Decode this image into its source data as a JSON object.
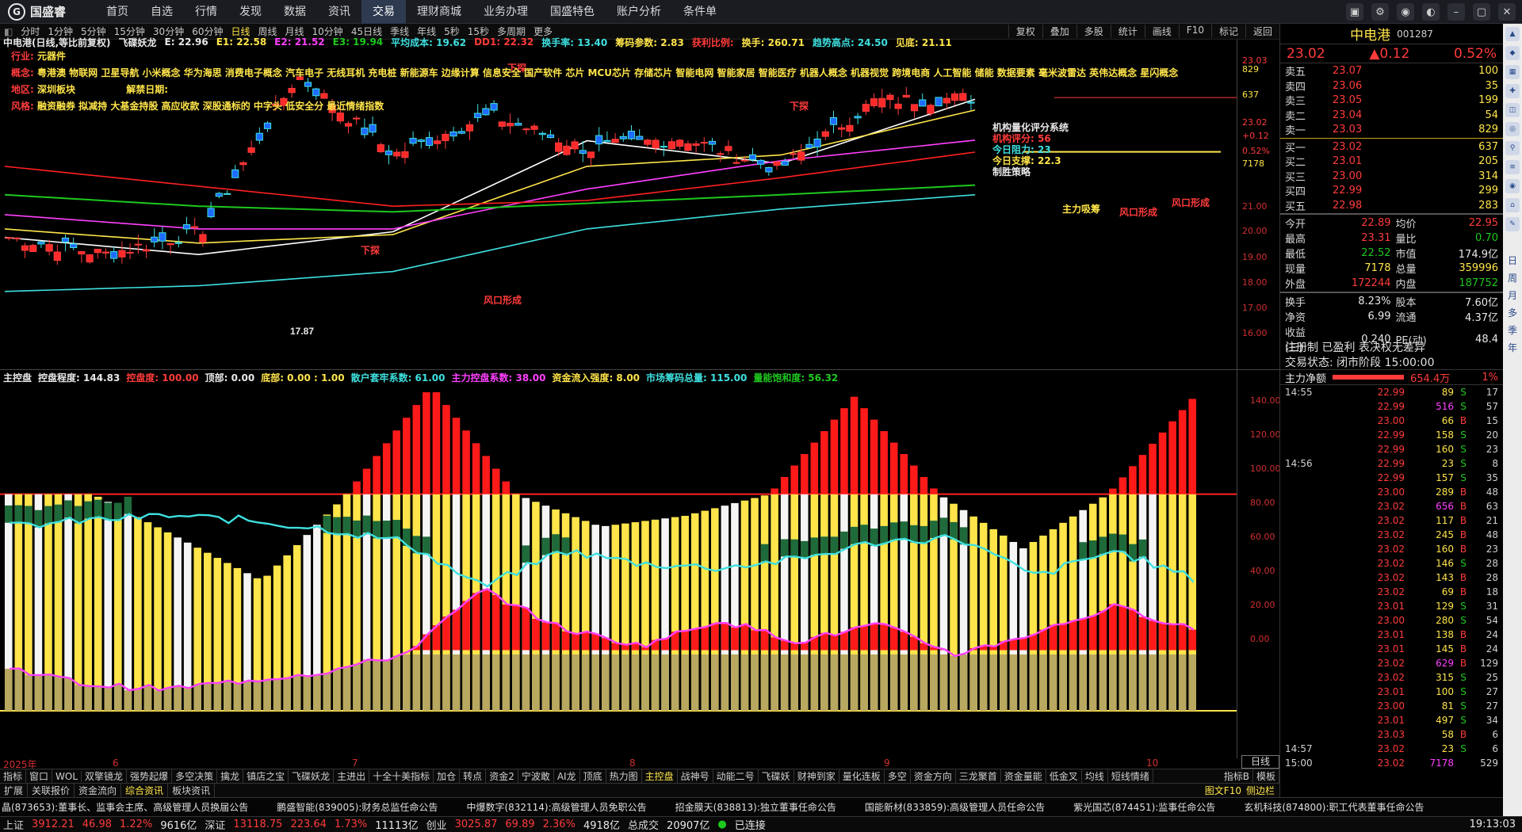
{
  "app": {
    "logo_text": "国盛睿"
  },
  "menu": [
    "首页",
    "自选",
    "行情",
    "发现",
    "数据",
    "资讯",
    "交易",
    "理财商城",
    "业务办理",
    "国盛特色",
    "账户分析",
    "条件单"
  ],
  "menu_active_index": 6,
  "periods": [
    "分时",
    "1分钟",
    "5分钟",
    "15分钟",
    "30分钟",
    "60分钟",
    "日线",
    "周线",
    "月线",
    "10分钟",
    "45日线",
    "季线",
    "年线",
    "5秒",
    "15秒",
    "多周期",
    "更多"
  ],
  "period_active_index": 6,
  "period_right": [
    "复权",
    "叠加",
    "多股",
    "统计",
    "画线",
    "F10",
    "标记",
    "返回"
  ],
  "info_line": [
    {
      "text": "中电港(日线,等比前复权)",
      "color": "#e8e8e8"
    },
    {
      "text": "飞碟妖龙",
      "color": "#e8e8e8"
    },
    {
      "text": "E: 22.96",
      "color": "#e8e8e8"
    },
    {
      "text": "E1: 22.58",
      "color": "#ffe54a"
    },
    {
      "text": "E2: 21.52",
      "color": "#ff40ff"
    },
    {
      "text": "E3: 19.94",
      "color": "#1ec81e"
    },
    {
      "text": "平均成本: 19.62",
      "color": "#3fe0e0"
    },
    {
      "text": "DD1: 22.32",
      "color": "#ff3b3b"
    },
    {
      "text": "换手率: 13.40",
      "color": "#3fe0e0"
    },
    {
      "text": "筹码参数: 2.83",
      "color": "#ffe54a"
    },
    {
      "text": "获利比例:",
      "color": "#ff3b3b"
    },
    {
      "text": "换手: 260.71",
      "color": "#ffe54a"
    },
    {
      "text": "趋势高点: 24.50",
      "color": "#3fe0e0"
    },
    {
      "text": "见底: 21.11",
      "color": "#ffe54a"
    }
  ],
  "overlay_text": {
    "industry_label": "行业:",
    "industry_value": "元器件",
    "concept_label": "概念:",
    "concept_value": "粤港澳 物联网 卫星导航 小米概念 华为海思 消费电子概念 汽车电子 无线耳机 充电桩 新能源车 边缘计算 信息安全 国产软件 芯片 MCU芯片 存储芯片 智能电网 智能家居 智能医疗 机器人概念 机器视觉 跨境电商 人工智能 储能 数据要素 毫米波雷达 英伟达概念 星闪概念",
    "region_label": "地区:",
    "region_value": "深圳板块",
    "unban_label": "解禁日期:",
    "style_label": "风格:",
    "style_value": "融资融券 拟减持 大基金持股 高应收款 深股通标的 中字头 低安全分 最近情绪指数",
    "rating_title": "机构量化评分系统",
    "rating_lines": [
      "机构评分: 56",
      "今日阻力: 23",
      "今日支撑: 22.3",
      "制胜策略"
    ],
    "annotations": [
      "风口形成",
      "风口形成",
      "风口形成",
      "主力吸筹",
      "下探",
      "下探",
      "下探",
      "17.87"
    ]
  },
  "price_axis": [
    "23.03",
    "829",
    "637",
    "23.02",
    "+0.12",
    "0.52%",
    "7178",
    "21.00",
    "20.00",
    "19.00",
    "18.00",
    "17.00",
    "16.00"
  ],
  "chart_data": [
    {
      "type": "line",
      "title": "中电港(日线,等比前复权)",
      "subtitle": "飞碟妖龙",
      "ylim": [
        16.0,
        24.5
      ],
      "x": [
        "2025-05",
        "2025-06",
        "2025-07",
        "2025-08",
        "2025-09",
        "2025-10"
      ],
      "series": [
        {
          "name": "E",
          "values": [
            18.1,
            17.5,
            18.3,
            21.5,
            20.7,
            22.96
          ]
        },
        {
          "name": "E1",
          "values": [
            18.4,
            17.9,
            18.2,
            20.6,
            21.0,
            22.58
          ]
        },
        {
          "name": "E2",
          "values": [
            18.9,
            18.4,
            18.4,
            19.8,
            20.8,
            21.52
          ]
        },
        {
          "name": "E3",
          "values": [
            19.6,
            19.2,
            19.0,
            19.3,
            19.6,
            19.94
          ]
        }
      ],
      "highlights": {
        "trend_high": 24.5,
        "bottom": 21.11
      }
    },
    {
      "type": "bar",
      "title": "主控盘",
      "ylim": [
        0,
        150
      ],
      "yticks": [
        0,
        20,
        40,
        60,
        80,
        100,
        120,
        140
      ],
      "categories": [
        "6",
        "7",
        "8",
        "9",
        "10"
      ],
      "series": [
        {
          "name": "控盘程度",
          "values": [
            100,
            100,
            100,
            100,
            144.83
          ]
        },
        {
          "name": "散户套牢系数",
          "values": [
            60,
            72,
            71,
            75,
            61
          ]
        },
        {
          "name": "主力控盘系数",
          "values": [
            12,
            17,
            31,
            35,
            38
          ]
        }
      ],
      "labels": {
        "控盘程度": "144.83",
        "控盘度": "100.00",
        "顶部": "0.00",
        "底部": "0.00 : 1.00",
        "散户套牢系数": "61.00",
        "主力控盘系数": "38.00",
        "资金流入强度": "8.00",
        "市场筹码总量": "115.00",
        "量能饱和度": "56.32"
      }
    }
  ],
  "sub_info": [
    {
      "text": "主控盘",
      "color": "#e8e8e8"
    },
    {
      "text": "控盘程度: 144.83",
      "color": "#e8e8e8"
    },
    {
      "text": "控盘度: 100.00",
      "color": "#ff3b3b"
    },
    {
      "text": "顶部: 0.00",
      "color": "#e8e8e8"
    },
    {
      "text": "底部: 0.00 : 1.00",
      "color": "#ffe54a"
    },
    {
      "text": "散户套牢系数: 61.00",
      "color": "#3fe0e0"
    },
    {
      "text": "主力控盘系数: 38.00",
      "color": "#ff40ff"
    },
    {
      "text": "资金流入强度: 8.00",
      "color": "#ffe54a"
    },
    {
      "text": "市场筹码总量: 115.00",
      "color": "#3fe0e0"
    },
    {
      "text": "量能饱和度: 56.32",
      "color": "#1ec81e"
    }
  ],
  "sub_axis": [
    "140.00",
    "120.00",
    "100.00",
    "80.00",
    "60.00",
    "40.00",
    "20.00",
    "0.00"
  ],
  "x_axis_labels": [
    "2025年",
    "6",
    "7",
    "8",
    "9",
    "10"
  ],
  "x_axis_label_box": "日线",
  "indicator_tabs": [
    "指标",
    "窗口",
    "WOL",
    "双擎镜龙",
    "强势起爆",
    "多空决策",
    "擒龙",
    "镇店之宝",
    "飞碟妖龙",
    "主进出",
    "十全十美指标",
    "加仓",
    "转点",
    "资金2",
    "宁波敢",
    "AI龙",
    "顶底",
    "热力图",
    "主控盘",
    "战神号",
    "动能二号",
    "飞碟妖",
    "财神到家",
    "量化连板",
    "多空",
    "资金方向",
    "三龙聚首",
    "资金量能",
    "低金叉",
    "均线",
    "短线情绪"
  ],
  "indicator_active_index": 18,
  "indicator_tabs_right": [
    "指标B",
    "模板"
  ],
  "tabs2": [
    "扩展",
    "关联报价",
    "资金流向",
    "综合资讯",
    "板块资讯"
  ],
  "tabs2_active_index": 3,
  "tabs2_right": [
    "图文F10",
    "侧边栏"
  ],
  "right_panel": {
    "name": "中电港",
    "code": "001287",
    "price": "23.02",
    "change": "▲0.12",
    "pct": "0.52%",
    "asks": [
      {
        "label": "卖五",
        "price": "23.07",
        "vol": "100"
      },
      {
        "label": "卖四",
        "price": "23.06",
        "vol": "35"
      },
      {
        "label": "卖三",
        "price": "23.05",
        "vol": "199"
      },
      {
        "label": "卖二",
        "price": "23.04",
        "vol": "54"
      },
      {
        "label": "卖一",
        "price": "23.03",
        "vol": "829"
      }
    ],
    "bids": [
      {
        "label": "买一",
        "price": "23.02",
        "vol": "637"
      },
      {
        "label": "买二",
        "price": "23.01",
        "vol": "205"
      },
      {
        "label": "买三",
        "price": "23.00",
        "vol": "314"
      },
      {
        "label": "买四",
        "price": "22.99",
        "vol": "299"
      },
      {
        "label": "买五",
        "price": "22.98",
        "vol": "283"
      }
    ],
    "stats": [
      {
        "k1": "今开",
        "v1": "22.89",
        "c1": "#ff3b3b",
        "k2": "均价",
        "v2": "22.95",
        "c2": "#ff3b3b"
      },
      {
        "k1": "最高",
        "v1": "23.31",
        "c1": "#ff3b3b",
        "k2": "量比",
        "v2": "0.70",
        "c2": "#1ec81e"
      },
      {
        "k1": "最低",
        "v1": "22.52",
        "c1": "#1ec81e",
        "k2": "市值",
        "v2": "174.9亿",
        "c2": "#e8e8e8"
      },
      {
        "k1": "现量",
        "v1": "7178",
        "c1": "#ffe54a",
        "k2": "总量",
        "v2": "359996",
        "c2": "#ffe54a"
      },
      {
        "k1": "外盘",
        "v1": "172244",
        "c1": "#ff3b3b",
        "k2": "内盘",
        "v2": "187752",
        "c2": "#1ec81e"
      }
    ],
    "stats2": [
      {
        "k1": "换手",
        "v1": "8.23%",
        "c1": "#e8e8e8",
        "k2": "股本",
        "v2": "7.60亿",
        "c2": "#e8e8e8"
      },
      {
        "k1": "净资",
        "v1": "6.99",
        "c1": "#e8e8e8",
        "k2": "流通",
        "v2": "4.37亿",
        "c2": "#e8e8e8"
      },
      {
        "k1": "收益(三)",
        "v1": "0.240",
        "c1": "#e8e8e8",
        "k2": "PE(动)",
        "v2": "48.4",
        "c2": "#e8e8e8"
      }
    ],
    "status1": "注册制 已盈利 表决权无差异",
    "status2": "交易状态: 闭市阶段 15:00:00",
    "netflow_label": "主力净额",
    "netflow_value": "654.4万",
    "netflow_pct": "1%",
    "ticks": [
      {
        "t": "14:55",
        "p": "22.99",
        "v": "89",
        "bs": "S",
        "n": "17"
      },
      {
        "t": "",
        "p": "22.99",
        "v": "516",
        "bs": "S",
        "n": "57"
      },
      {
        "t": "",
        "p": "23.00",
        "v": "66",
        "bs": "B",
        "n": "15"
      },
      {
        "t": "",
        "p": "22.99",
        "v": "158",
        "bs": "S",
        "n": "20"
      },
      {
        "t": "",
        "p": "22.99",
        "v": "160",
        "bs": "S",
        "n": "23"
      },
      {
        "t": "14:56",
        "p": "22.99",
        "v": "23",
        "bs": "S",
        "n": "8"
      },
      {
        "t": "",
        "p": "22.99",
        "v": "157",
        "bs": "S",
        "n": "35"
      },
      {
        "t": "",
        "p": "23.00",
        "v": "289",
        "bs": "B",
        "n": "48"
      },
      {
        "t": "",
        "p": "23.02",
        "v": "656",
        "bs": "B",
        "n": "63"
      },
      {
        "t": "",
        "p": "23.02",
        "v": "117",
        "bs": "B",
        "n": "21"
      },
      {
        "t": "",
        "p": "23.02",
        "v": "245",
        "bs": "B",
        "n": "48"
      },
      {
        "t": "",
        "p": "23.02",
        "v": "160",
        "bs": "B",
        "n": "23"
      },
      {
        "t": "",
        "p": "23.02",
        "v": "146",
        "bs": "S",
        "n": "28"
      },
      {
        "t": "",
        "p": "23.02",
        "v": "143",
        "bs": "B",
        "n": "28"
      },
      {
        "t": "",
        "p": "23.02",
        "v": "69",
        "bs": "B",
        "n": "18"
      },
      {
        "t": "",
        "p": "23.01",
        "v": "129",
        "bs": "S",
        "n": "31"
      },
      {
        "t": "",
        "p": "23.00",
        "v": "280",
        "bs": "S",
        "n": "54"
      },
      {
        "t": "",
        "p": "23.01",
        "v": "138",
        "bs": "B",
        "n": "24"
      },
      {
        "t": "",
        "p": "23.01",
        "v": "145",
        "bs": "B",
        "n": "24"
      },
      {
        "t": "",
        "p": "23.02",
        "v": "629",
        "bs": "B",
        "n": "129"
      },
      {
        "t": "",
        "p": "23.02",
        "v": "315",
        "bs": "S",
        "n": "25"
      },
      {
        "t": "",
        "p": "23.01",
        "v": "100",
        "bs": "S",
        "n": "27"
      },
      {
        "t": "",
        "p": "23.00",
        "v": "81",
        "bs": "S",
        "n": "27"
      },
      {
        "t": "",
        "p": "23.01",
        "v": "497",
        "bs": "S",
        "n": "34"
      },
      {
        "t": "",
        "p": "23.03",
        "v": "58",
        "bs": "B",
        "n": "6"
      },
      {
        "t": "14:57",
        "p": "23.02",
        "v": "23",
        "bs": "S",
        "n": "6"
      },
      {
        "t": "15:00",
        "p": "23.02",
        "v": "7178",
        "bs": "",
        "n": "529"
      }
    ],
    "tabs": [
      "笔",
      "价",
      "细",
      "势",
      "联",
      "值",
      "主",
      "筹"
    ]
  },
  "side_strip_text": [
    "日",
    "周",
    "月",
    "多",
    "季",
    "年"
  ],
  "news": [
    "晶(873653):董事长、监事会主席、高级管理人员换届公告",
    "鹏盛智能(839005):财务总监任命公告",
    "中爆数字(832114):高级管理人员免职公告",
    "招金膜天(838813):独立董事任命公告",
    "国能新材(833859):高级管理人员任命公告",
    "紫光国芯(874451):监事任命公告",
    "玄机科技(874800):职工代表董事任命公告"
  ],
  "statusbar": {
    "sh_label": "上证",
    "sh_val": "3912.21",
    "sh_chg": "46.98",
    "sh_pct": "1.22%",
    "sh_amt": "9616亿",
    "sz_label": "深证",
    "sz_val": "13118.75",
    "sz_chg": "223.64",
    "sz_pct": "1.73%",
    "sz_amt": "11113亿",
    "cy_label": "创业",
    "cy_val": "3025.87",
    "cy_chg": "69.89",
    "cy_pct": "2.36%",
    "cy_amt": "4918亿",
    "total_label": "总成交",
    "total_amt": "20907亿",
    "conn": "已连接",
    "time": "19:13:03"
  },
  "colors": {
    "up": "#ff3b3b",
    "down": "#1ec81e",
    "yellow": "#ffe54a",
    "cyan": "#3fe0e0",
    "magenta": "#ff40ff",
    "background": "#000000"
  }
}
